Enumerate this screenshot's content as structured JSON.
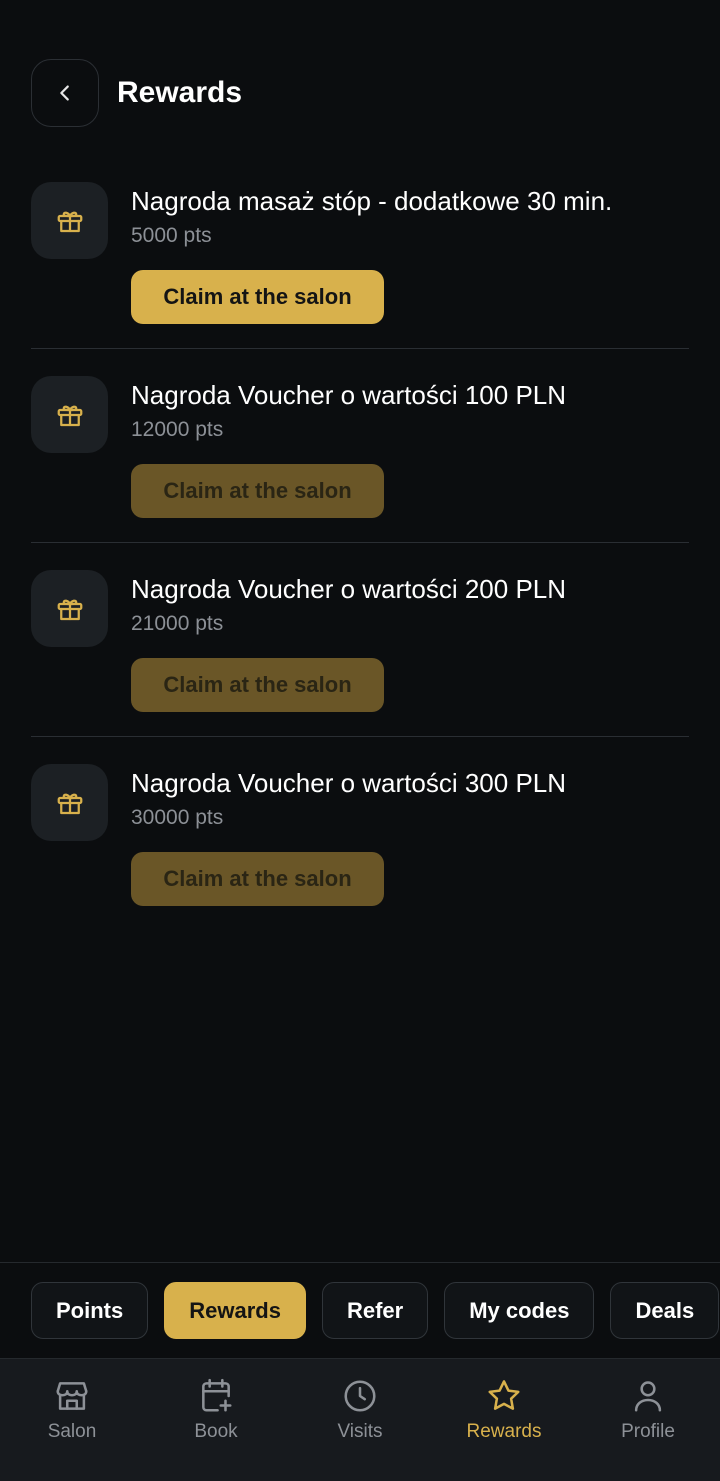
{
  "header": {
    "title": "Rewards"
  },
  "rewards": [
    {
      "title": "Nagroda masaż stóp - dodatkowe 30 min.",
      "points": "5000 pts",
      "button": "Claim at the salon",
      "enabled": true
    },
    {
      "title": "Nagroda Voucher o wartości 100 PLN",
      "points": "12000 pts",
      "button": "Claim at the salon",
      "enabled": false
    },
    {
      "title": "Nagroda Voucher o wartości 200 PLN",
      "points": "21000 pts",
      "button": "Claim at the salon",
      "enabled": false
    },
    {
      "title": "Nagroda Voucher o wartości 300 PLN",
      "points": "30000 pts",
      "button": "Claim at the salon",
      "enabled": false
    }
  ],
  "tabs": [
    {
      "label": "Points",
      "active": false
    },
    {
      "label": "Rewards",
      "active": true
    },
    {
      "label": "Refer",
      "active": false
    },
    {
      "label": "My codes",
      "active": false
    },
    {
      "label": "Deals",
      "active": false
    }
  ],
  "nav": [
    {
      "label": "Salon",
      "icon": "store-icon",
      "active": false
    },
    {
      "label": "Book",
      "icon": "calendar-plus-icon",
      "active": false
    },
    {
      "label": "Visits",
      "icon": "clock-icon",
      "active": false
    },
    {
      "label": "Rewards",
      "icon": "star-icon",
      "active": true
    },
    {
      "label": "Profile",
      "icon": "user-icon",
      "active": false
    }
  ],
  "colors": {
    "accent": "#d8b14c",
    "background": "#0b0d0f",
    "muted": "#8d9197"
  }
}
